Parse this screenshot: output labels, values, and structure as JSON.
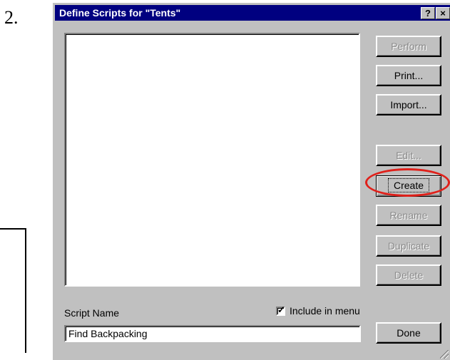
{
  "step_number": "2.",
  "dialog": {
    "title": "Define Scripts for \"Tents\"",
    "help_glyph": "?",
    "close_glyph": "×"
  },
  "buttons": {
    "perform": "Perform",
    "print": "Print...",
    "import": "Import...",
    "edit": "Edit...",
    "create": "Create",
    "rename": "Rename",
    "duplicate": "Duplicate",
    "delete": "Delete",
    "done": "Done"
  },
  "script_name_label": "Script Name",
  "include_in_menu_label": "Include in menu",
  "include_in_menu_checked": true,
  "script_name_value": "Find Backpacking",
  "highlight_color": "#e0201a"
}
